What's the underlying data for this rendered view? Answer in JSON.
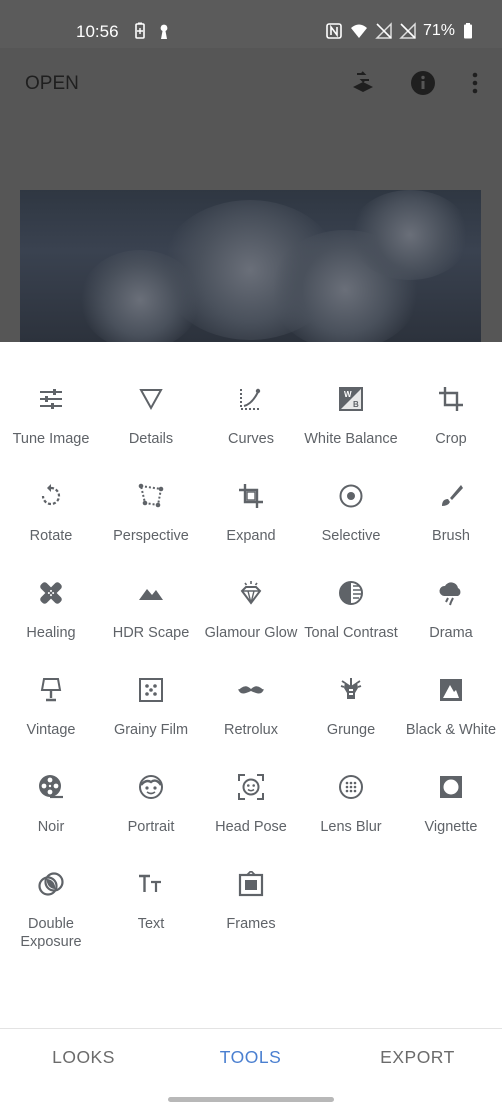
{
  "status_bar": {
    "time": "10:56",
    "battery": "71%"
  },
  "app_bar": {
    "open_label": "OPEN"
  },
  "tools": [
    {
      "label": "Tune Image",
      "icon": "tune-icon"
    },
    {
      "label": "Details",
      "icon": "details-triangle-icon"
    },
    {
      "label": "Curves",
      "icon": "curves-icon"
    },
    {
      "label": "White Balance",
      "icon": "white-balance-icon"
    },
    {
      "label": "Crop",
      "icon": "crop-icon"
    },
    {
      "label": "Rotate",
      "icon": "rotate-icon"
    },
    {
      "label": "Perspective",
      "icon": "perspective-icon"
    },
    {
      "label": "Expand",
      "icon": "expand-icon"
    },
    {
      "label": "Selective",
      "icon": "selective-icon"
    },
    {
      "label": "Brush",
      "icon": "brush-icon"
    },
    {
      "label": "Healing",
      "icon": "healing-icon"
    },
    {
      "label": "HDR Scape",
      "icon": "mountains-icon"
    },
    {
      "label": "Glamour Glow",
      "icon": "diamond-icon"
    },
    {
      "label": "Tonal Contrast",
      "icon": "tonal-contrast-icon"
    },
    {
      "label": "Drama",
      "icon": "cloud-rain-icon"
    },
    {
      "label": "Vintage",
      "icon": "lamp-icon"
    },
    {
      "label": "Grainy Film",
      "icon": "grain-icon"
    },
    {
      "label": "Retrolux",
      "icon": "mustache-icon"
    },
    {
      "label": "Grunge",
      "icon": "guitar-icon"
    },
    {
      "label": "Black & White",
      "icon": "black-white-icon"
    },
    {
      "label": "Noir",
      "icon": "film-reel-icon"
    },
    {
      "label": "Portrait",
      "icon": "face-icon"
    },
    {
      "label": "Head Pose",
      "icon": "head-pose-icon"
    },
    {
      "label": "Lens Blur",
      "icon": "lens-blur-icon"
    },
    {
      "label": "Vignette",
      "icon": "vignette-icon"
    },
    {
      "label": "Double Exposure",
      "icon": "double-exposure-icon"
    },
    {
      "label": "Text",
      "icon": "text-icon"
    },
    {
      "label": "Frames",
      "icon": "frames-icon"
    }
  ],
  "tabs": {
    "looks": "LOOKS",
    "tools": "TOOLS",
    "export": "EXPORT"
  },
  "colors": {
    "active_tab": "#4a7fd0",
    "icon_gray": "#5f6368",
    "scrim": "#565656"
  }
}
